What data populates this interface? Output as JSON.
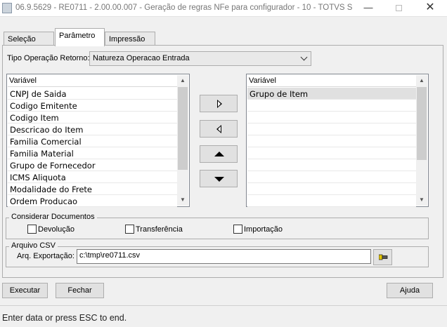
{
  "window": {
    "title": "06.9.5629 - RE0711 - 2.00.00.007 - Geração de regras NFe para configurador - 10 - TOTVS S...",
    "minimize_glyph": "—",
    "close_glyph": "✕"
  },
  "tabs": [
    {
      "label": "Seleção"
    },
    {
      "label": "Parâmetro"
    },
    {
      "label": "Impressão"
    }
  ],
  "tipo_operacao": {
    "label": "Tipo Operação Retorno:",
    "value": "Natureza Operacao Entrada"
  },
  "left_list": {
    "header": "Variável",
    "items": [
      "CNPJ de Saida",
      "Codigo Emitente",
      "Codigo Item",
      "Descricao do Item",
      "Familia Comercial",
      "Familia Material",
      "Grupo de Fornecedor",
      "ICMS Aliquota",
      "Modalidade do Frete",
      "Ordem Producao"
    ]
  },
  "right_list": {
    "header": "Variável",
    "items": [
      "Grupo de Item"
    ],
    "empty_rows": 9
  },
  "move_buttons": {
    "icons": [
      "arrow-right-icon",
      "arrow-left-icon",
      "arrow-up-icon",
      "arrow-down-icon"
    ]
  },
  "considerar": {
    "title": "Considerar Documentos",
    "options": [
      {
        "label": "Devolução",
        "checked": false
      },
      {
        "label": "Transferência",
        "checked": false
      },
      {
        "label": "Importação",
        "checked": false
      }
    ]
  },
  "arquivo": {
    "title": "Arquivo CSV",
    "label": "Arq. Exportação:",
    "value": "c:\\tmp\\re0711.csv"
  },
  "footer": {
    "executar": "Executar",
    "fechar": "Fechar",
    "ajuda": "Ajuda"
  },
  "status": "Enter data or press ESC to end."
}
